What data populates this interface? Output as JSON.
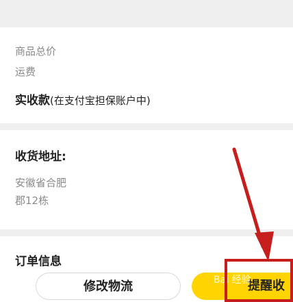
{
  "price_section": {
    "total_label": "商品总价",
    "shipping_label": "运费",
    "received_label": "实收款",
    "received_note": "(在支付宝担保账户中)"
  },
  "address_section": {
    "title": "收货地址:",
    "line1": "安徽省合肥",
    "line2": "郡12栋"
  },
  "order_section": {
    "title": "订单信息"
  },
  "bottom_bar": {
    "modify_logistics": "修改物流",
    "remind": "提醒收"
  },
  "watermark": "Bai 经验",
  "colors": {
    "accent": "#ffd400",
    "annotation": "#c61d1d"
  }
}
